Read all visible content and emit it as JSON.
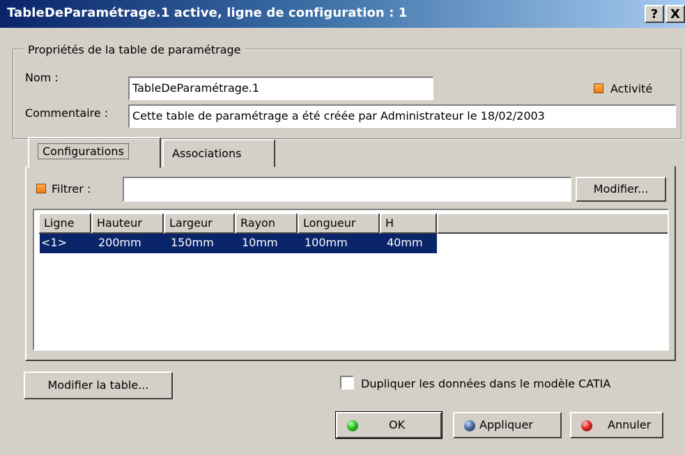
{
  "window": {
    "title": "TableDeParamétrage.1 active, ligne de configuration : 1",
    "help_label": "?",
    "close_label": "X"
  },
  "properties": {
    "group_label": "Propriétés de la table de paramétrage",
    "name_label": "Nom :",
    "name_value": "TableDeParamétrage.1",
    "activity_label": "Activité",
    "activity_checked": true,
    "comment_label": "Commentaire :",
    "comment_value": "Cette table de paramétrage a été créée par Administrateur le 18/02/2003"
  },
  "tabs": [
    {
      "label": "Configurations",
      "active": true
    },
    {
      "label": "Associations",
      "active": false
    }
  ],
  "filter": {
    "label": "Filtrer :",
    "checked": true,
    "value": "",
    "modify_label": "Modifier..."
  },
  "table": {
    "columns": [
      "Ligne",
      "Hauteur",
      "Largeur",
      "Rayon",
      "Longueur",
      "H"
    ],
    "rows": [
      [
        "<1>",
        "200mm",
        "150mm",
        "10mm",
        "100mm",
        "40mm"
      ]
    ]
  },
  "footer": {
    "edit_table_label": "Modifier la table...",
    "duplicate_label": "Dupliquer les données dans le modèle CATIA",
    "duplicate_checked": false,
    "ok_label": "OK",
    "apply_label": "Appliquer",
    "cancel_label": "Annuler"
  },
  "colors": {
    "dialog_bg": "#d4d0c8",
    "title_start": "#0a246a",
    "title_end": "#a6caf0",
    "selection": "#0a246a",
    "checkbox_orange": "#ee7b10"
  }
}
